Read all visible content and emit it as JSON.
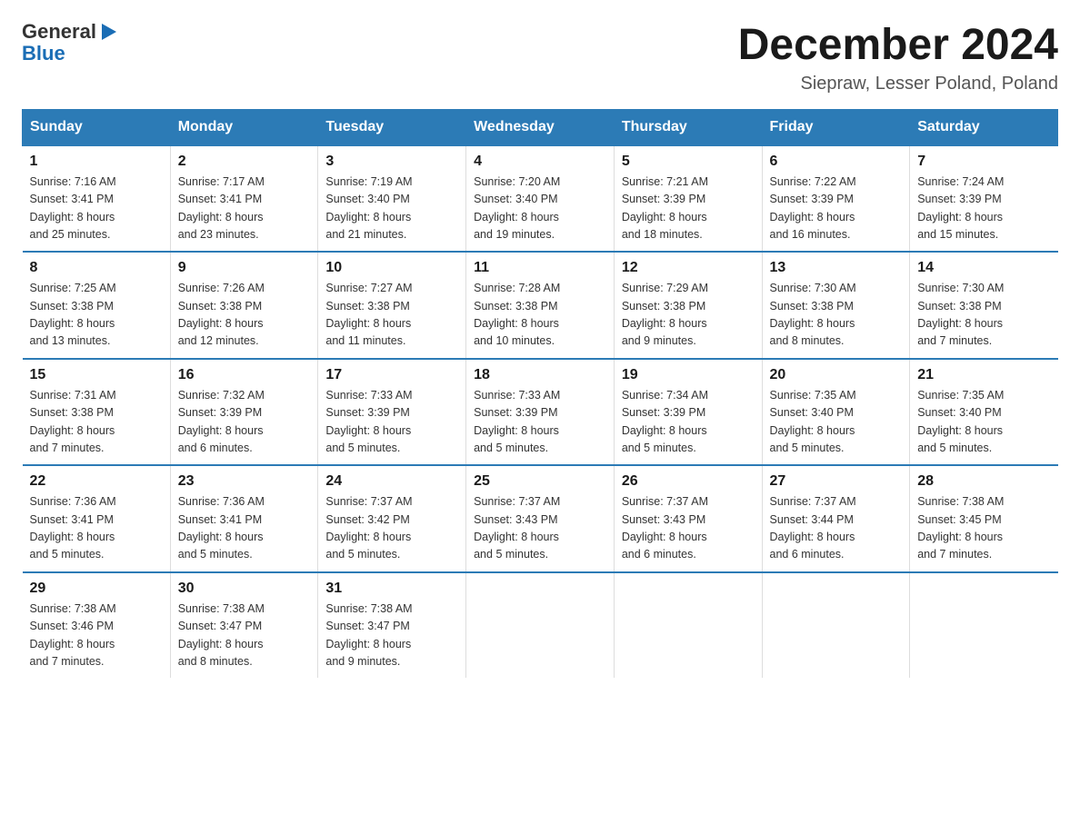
{
  "logo": {
    "general": "General",
    "blue": "Blue",
    "triangle": "▶"
  },
  "title": "December 2024",
  "subtitle": "Siepraw, Lesser Poland, Poland",
  "weekdays": [
    "Sunday",
    "Monday",
    "Tuesday",
    "Wednesday",
    "Thursday",
    "Friday",
    "Saturday"
  ],
  "weeks": [
    [
      {
        "day": "1",
        "sunrise": "7:16 AM",
        "sunset": "3:41 PM",
        "daylight": "8 hours and 25 minutes."
      },
      {
        "day": "2",
        "sunrise": "7:17 AM",
        "sunset": "3:41 PM",
        "daylight": "8 hours and 23 minutes."
      },
      {
        "day": "3",
        "sunrise": "7:19 AM",
        "sunset": "3:40 PM",
        "daylight": "8 hours and 21 minutes."
      },
      {
        "day": "4",
        "sunrise": "7:20 AM",
        "sunset": "3:40 PM",
        "daylight": "8 hours and 19 minutes."
      },
      {
        "day": "5",
        "sunrise": "7:21 AM",
        "sunset": "3:39 PM",
        "daylight": "8 hours and 18 minutes."
      },
      {
        "day": "6",
        "sunrise": "7:22 AM",
        "sunset": "3:39 PM",
        "daylight": "8 hours and 16 minutes."
      },
      {
        "day": "7",
        "sunrise": "7:24 AM",
        "sunset": "3:39 PM",
        "daylight": "8 hours and 15 minutes."
      }
    ],
    [
      {
        "day": "8",
        "sunrise": "7:25 AM",
        "sunset": "3:38 PM",
        "daylight": "8 hours and 13 minutes."
      },
      {
        "day": "9",
        "sunrise": "7:26 AM",
        "sunset": "3:38 PM",
        "daylight": "8 hours and 12 minutes."
      },
      {
        "day": "10",
        "sunrise": "7:27 AM",
        "sunset": "3:38 PM",
        "daylight": "8 hours and 11 minutes."
      },
      {
        "day": "11",
        "sunrise": "7:28 AM",
        "sunset": "3:38 PM",
        "daylight": "8 hours and 10 minutes."
      },
      {
        "day": "12",
        "sunrise": "7:29 AM",
        "sunset": "3:38 PM",
        "daylight": "8 hours and 9 minutes."
      },
      {
        "day": "13",
        "sunrise": "7:30 AM",
        "sunset": "3:38 PM",
        "daylight": "8 hours and 8 minutes."
      },
      {
        "day": "14",
        "sunrise": "7:30 AM",
        "sunset": "3:38 PM",
        "daylight": "8 hours and 7 minutes."
      }
    ],
    [
      {
        "day": "15",
        "sunrise": "7:31 AM",
        "sunset": "3:38 PM",
        "daylight": "8 hours and 7 minutes."
      },
      {
        "day": "16",
        "sunrise": "7:32 AM",
        "sunset": "3:39 PM",
        "daylight": "8 hours and 6 minutes."
      },
      {
        "day": "17",
        "sunrise": "7:33 AM",
        "sunset": "3:39 PM",
        "daylight": "8 hours and 5 minutes."
      },
      {
        "day": "18",
        "sunrise": "7:33 AM",
        "sunset": "3:39 PM",
        "daylight": "8 hours and 5 minutes."
      },
      {
        "day": "19",
        "sunrise": "7:34 AM",
        "sunset": "3:39 PM",
        "daylight": "8 hours and 5 minutes."
      },
      {
        "day": "20",
        "sunrise": "7:35 AM",
        "sunset": "3:40 PM",
        "daylight": "8 hours and 5 minutes."
      },
      {
        "day": "21",
        "sunrise": "7:35 AM",
        "sunset": "3:40 PM",
        "daylight": "8 hours and 5 minutes."
      }
    ],
    [
      {
        "day": "22",
        "sunrise": "7:36 AM",
        "sunset": "3:41 PM",
        "daylight": "8 hours and 5 minutes."
      },
      {
        "day": "23",
        "sunrise": "7:36 AM",
        "sunset": "3:41 PM",
        "daylight": "8 hours and 5 minutes."
      },
      {
        "day": "24",
        "sunrise": "7:37 AM",
        "sunset": "3:42 PM",
        "daylight": "8 hours and 5 minutes."
      },
      {
        "day": "25",
        "sunrise": "7:37 AM",
        "sunset": "3:43 PM",
        "daylight": "8 hours and 5 minutes."
      },
      {
        "day": "26",
        "sunrise": "7:37 AM",
        "sunset": "3:43 PM",
        "daylight": "8 hours and 6 minutes."
      },
      {
        "day": "27",
        "sunrise": "7:37 AM",
        "sunset": "3:44 PM",
        "daylight": "8 hours and 6 minutes."
      },
      {
        "day": "28",
        "sunrise": "7:38 AM",
        "sunset": "3:45 PM",
        "daylight": "8 hours and 7 minutes."
      }
    ],
    [
      {
        "day": "29",
        "sunrise": "7:38 AM",
        "sunset": "3:46 PM",
        "daylight": "8 hours and 7 minutes."
      },
      {
        "day": "30",
        "sunrise": "7:38 AM",
        "sunset": "3:47 PM",
        "daylight": "8 hours and 8 minutes."
      },
      {
        "day": "31",
        "sunrise": "7:38 AM",
        "sunset": "3:47 PM",
        "daylight": "8 hours and 9 minutes."
      },
      null,
      null,
      null,
      null
    ]
  ],
  "labels": {
    "sunrise": "Sunrise:",
    "sunset": "Sunset:",
    "daylight": "Daylight:"
  }
}
